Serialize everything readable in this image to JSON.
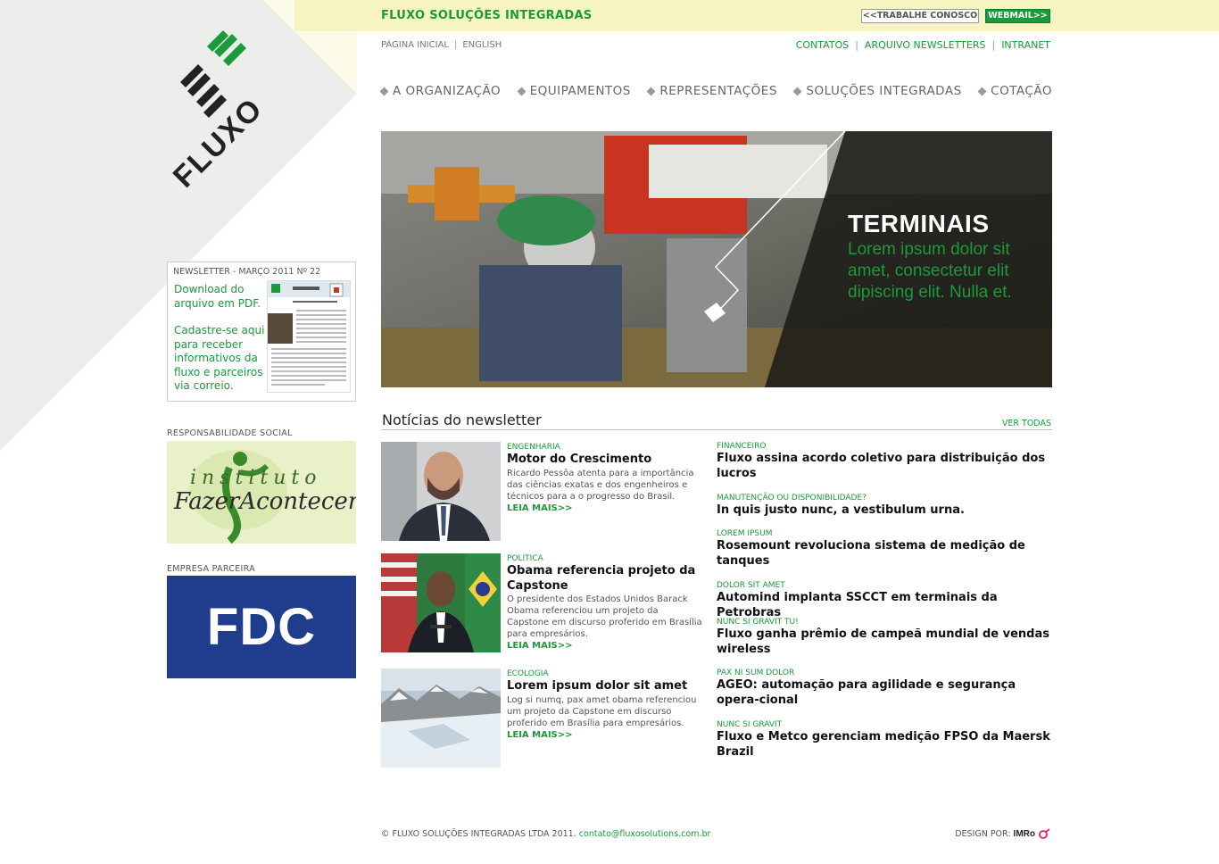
{
  "topbar": {
    "brand": "FLUXO SOLUÇÕES INTEGRADAS",
    "trabalhe_label": "<<TRABALHE CONOSCO",
    "webmail_label": "WEBMAIL>>"
  },
  "utilnav": {
    "left": [
      "PÁGINA INICIAL",
      "ENGLISH"
    ],
    "right": [
      "CONTATOS",
      "ARQUIVO NEWSLETTERS",
      "INTRANET"
    ]
  },
  "mainnav": [
    "A ORGANIZAÇÃO",
    "EQUIPAMENTOS",
    "REPRESENTAÇÕES",
    "SOLUÇÕES INTEGRADAS",
    "COTAÇÃO"
  ],
  "logo": {
    "text": "FLUXO"
  },
  "hero": {
    "title": "TERMINAIS",
    "text": "Lorem ipsum dolor sit amet, consectetur elit dipiscing elit. Nulla et."
  },
  "newsletter": {
    "title": "NEWSLETTER - MARÇO 2011 Nº 22",
    "download": "Download do arquivo em PDF.",
    "signup": "Cadastre-se aqui para receber informativos da fluxo e parceiros via correio."
  },
  "sidebar": {
    "social_label": "RESPONSABILIDADE SOCIAL",
    "partner_label": "EMPRESA PARCEIRA",
    "partner_logo": "FDC",
    "social_logo_line1": "instituto",
    "social_logo_line2": "FazerAcontecer"
  },
  "news": {
    "heading": "Notícias do newsletter",
    "view_all": "VER TODAS",
    "featured": [
      {
        "category": "ENGENHARIA",
        "title": "Motor do Crescimento",
        "desc": "Ricardo Pessôa  atenta para a importância das ciências exatas e dos engenheiros e técnicos para a o progresso do Brasil.",
        "more": "LEIA MAIS>>"
      },
      {
        "category": "POLÍTICA",
        "title": "Obama referencia projeto da Capstone",
        "desc": "O presidente dos Estados Unidos Barack Obama referenciou um projeto da Capstone em discurso proferido em Brasília para empresários.",
        "more": "LEIA MAIS>>"
      },
      {
        "category": "ECOLOGIA",
        "title": "Lorem ipsum dolor sit amet",
        "desc": "Log si numq, pax amet obama referenciou um projeto da Capstone em discurso proferido em Brasília para empresários.",
        "more": "LEIA MAIS>>"
      }
    ],
    "list": [
      {
        "category": "FINANCEIRO",
        "title": "Fluxo assina acordo coletivo para distribuição dos lucros"
      },
      {
        "category": "MANUTENÇÃO OU DISPONIBILIDADE?",
        "title": "In quis justo nunc, a vestibulum urna."
      },
      {
        "category": "LOREM IPSUM",
        "title": "Rosemount revoluciona sistema de medição de tanques"
      },
      {
        "category": "DOLOR SIT AMET",
        "title": "Automind implanta SSCCT em terminais da Petrobras"
      },
      {
        "category": "NUNC SI GRAVIT TU!",
        "title": "Fluxo ganha prêmio de campeã mundial de vendas wireless"
      },
      {
        "category": "PAX NI SUM DOLOR",
        "title": "AGEO: automação para agilidade e segurança opera-cional"
      },
      {
        "category": "NUNC SI GRAVIT",
        "title": "Fluxo e Metco gerenciam medição FPSO da Maersk Brazil"
      }
    ]
  },
  "footer": {
    "copyright": "© FLUXO SOLUÇÕES INTEGRADAS LTDA 2011.",
    "email": "contato@fluxosolutions.com.br",
    "design_label": "DESIGN POR:",
    "designer": "IMRo"
  },
  "colors": {
    "brand_green": "#1a9a3a",
    "topbar_bg": "#f6f4c0",
    "partner_blue": "#1f3d8c"
  }
}
